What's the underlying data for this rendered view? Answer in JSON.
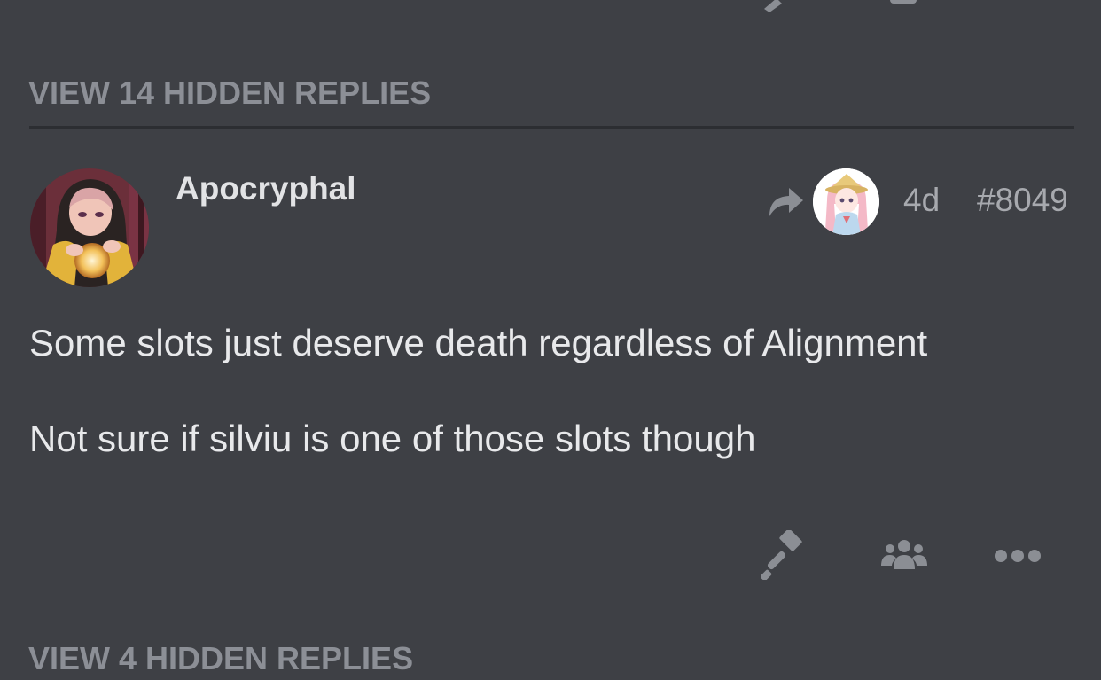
{
  "thread": {
    "hidden_replies_top": "VIEW 14 HIDDEN REPLIES",
    "hidden_replies_bottom": "VIEW 4 HIDDEN REPLIES"
  },
  "post": {
    "author": "Apocryphal",
    "time": "4d",
    "number": "#8049",
    "body": [
      "Some slots just deserve death regardless of Alignment",
      "Not sure if silviu is one of those slots though"
    ],
    "reply_to_icon": "reply-arrow-icon",
    "actions": [
      "gavel-icon",
      "group-icon",
      "more-options-icon"
    ]
  },
  "colors": {
    "background": "#3e4045",
    "muted_text": "#8c8f96",
    "body_text": "#e8e9eb",
    "meta_text": "#a7a9ae",
    "icon": "#8b8e94"
  }
}
